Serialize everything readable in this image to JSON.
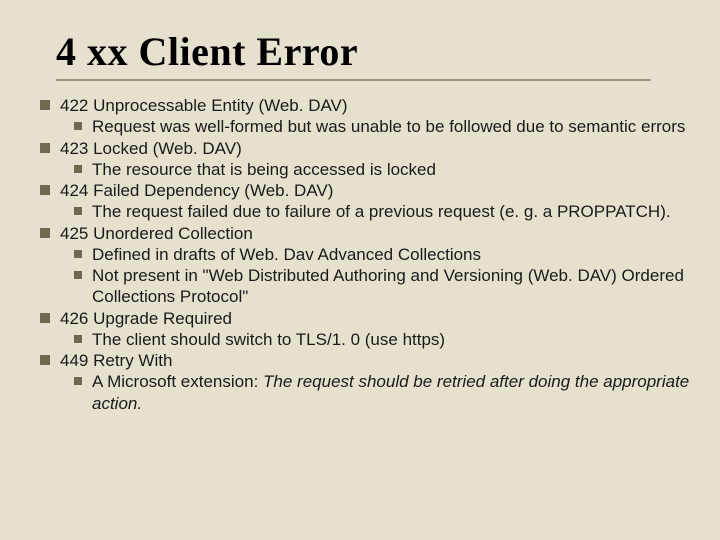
{
  "title": "4 xx Client Error",
  "items": [
    {
      "label": "422 Unprocessable Entity (Web. DAV)",
      "subs": [
        {
          "text": "Request was well-formed but was unable to be followed due to semantic errors"
        }
      ]
    },
    {
      "label": "423 Locked (Web. DAV)",
      "subs": [
        {
          "text": "The resource that is being accessed is locked"
        }
      ]
    },
    {
      "label": "424 Failed Dependency (Web. DAV)",
      "subs": [
        {
          "text": "The request failed due to failure of a previous request (e. g. a PROPPATCH)."
        }
      ]
    },
    {
      "label": "425 Unordered Collection",
      "subs": [
        {
          "text": "Defined in drafts of Web. Dav Advanced Collections"
        },
        {
          "text": "Not present in \"Web Distributed Authoring and Versioning (Web. DAV) Ordered Collections Protocol\""
        }
      ]
    },
    {
      "label": "426 Upgrade Required",
      "subs": [
        {
          "text": "The client should switch to TLS/1. 0 (use https)"
        }
      ]
    },
    {
      "label": "449 Retry With",
      "subs": [
        {
          "prefix": "A Microsoft extension: ",
          "italic": "The request should be retried after doing the appropriate action."
        }
      ]
    }
  ]
}
